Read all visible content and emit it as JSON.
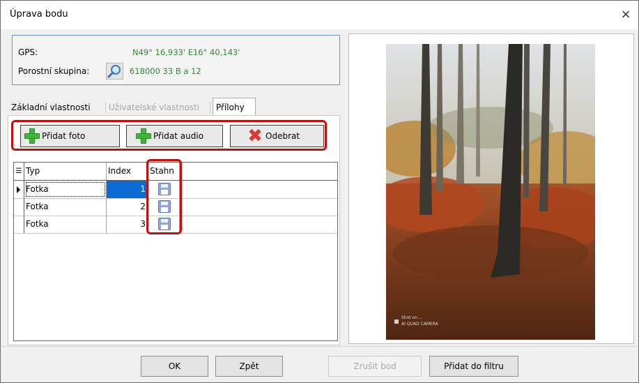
{
  "window": {
    "title": "Úprava bodu",
    "close_glyph": "×"
  },
  "gps": {
    "label": "GPS:",
    "value": "N49° 16,933' E16° 40,143'",
    "porostni_label": "Porostní skupina:",
    "porostni_value": "618000  33 B  a  12",
    "porostni_icon": "magnifier-icon"
  },
  "tabs": [
    {
      "label": "Základní vlastnosti"
    },
    {
      "label": "Uživatelské vlastnosti",
      "disabled": true
    },
    {
      "label": "Přílohy",
      "active": true
    }
  ],
  "toolbar": {
    "add_photo": "Přidat foto",
    "add_audio": "Přidat audio",
    "remove": "Odebrat"
  },
  "grid": {
    "columns": [
      "Typ",
      "Index",
      "Stahn"
    ],
    "rows": [
      {
        "typ": "Fotka",
        "index": "1",
        "selected": true
      },
      {
        "typ": "Fotka",
        "index": "2"
      },
      {
        "typ": "Fotka",
        "index": "3"
      }
    ]
  },
  "photo": {
    "watermark_line1": "Shot on ...",
    "watermark_line2": "AI QUAD CAMERA"
  },
  "buttons": {
    "ok": "OK",
    "zpet": "Zpět",
    "zrusit_bod": "Zrušit bod",
    "pridat_do_filtru": "Přidat do filtru"
  },
  "colors": {
    "highlight_red": "#c20e0e",
    "gps_text": "#2e8b2e",
    "selection_blue": "#0d6cd3"
  }
}
